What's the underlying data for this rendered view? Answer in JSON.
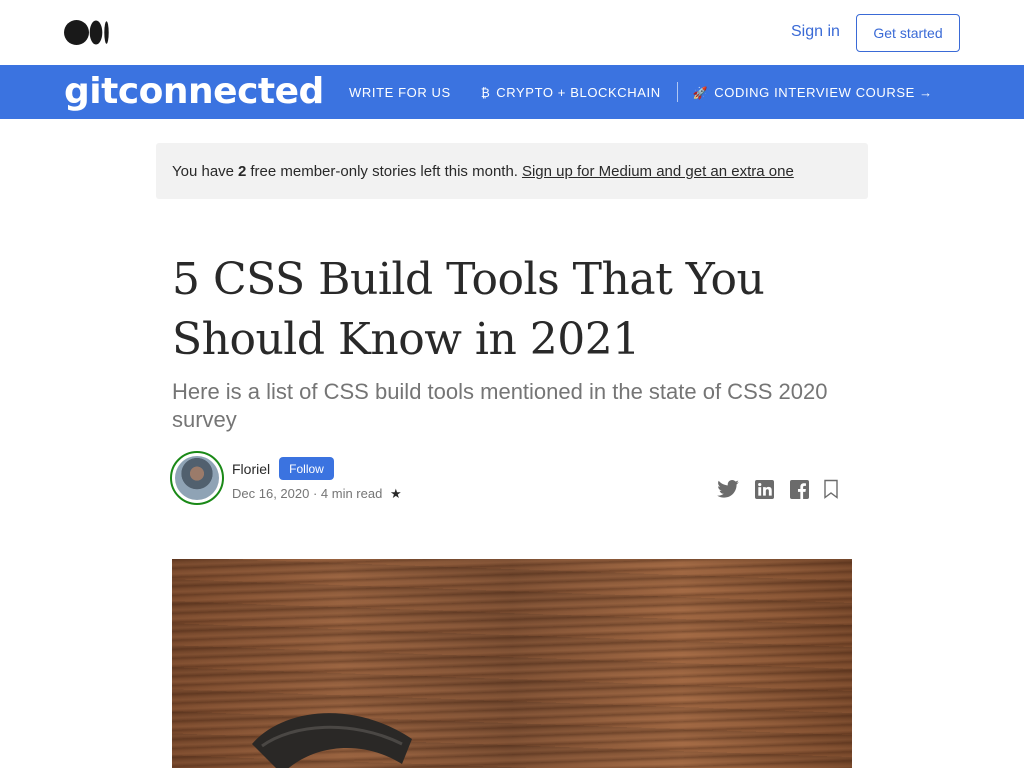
{
  "topbar": {
    "signin_label": "Sign in",
    "getstarted_label": "Get started"
  },
  "publication": {
    "name": "gitconnected",
    "nav": [
      {
        "label": "WRITE FOR US",
        "icon": ""
      },
      {
        "label": "CRYPTO + BLOCKCHAIN",
        "icon": "bitcoin-icon",
        "glyph": "₿"
      },
      {
        "label": "CODING INTERVIEW COURSE →",
        "icon": "rocket-icon",
        "glyph": "🚀"
      }
    ],
    "accent": "#3b73e0"
  },
  "member_banner": {
    "prefix": "You have",
    "count": "2",
    "suffix": "free member-only stories left this month.",
    "signup_label": "Sign up for Medium and get an extra one"
  },
  "article": {
    "title_line1": "5 CSS Build Tools That You",
    "title_line2": "Should Know in 2021",
    "subtitle": "Here is a list of CSS build tools mentioned in the state of CSS 2020 survey",
    "author": "Floriel",
    "follow_label": "Follow",
    "date": "Dec 16, 2020",
    "read_time": "4 min read",
    "member_star": "★"
  },
  "share_icons": [
    "twitter-icon",
    "linkedin-icon",
    "facebook-icon",
    "bookmark-icon"
  ]
}
